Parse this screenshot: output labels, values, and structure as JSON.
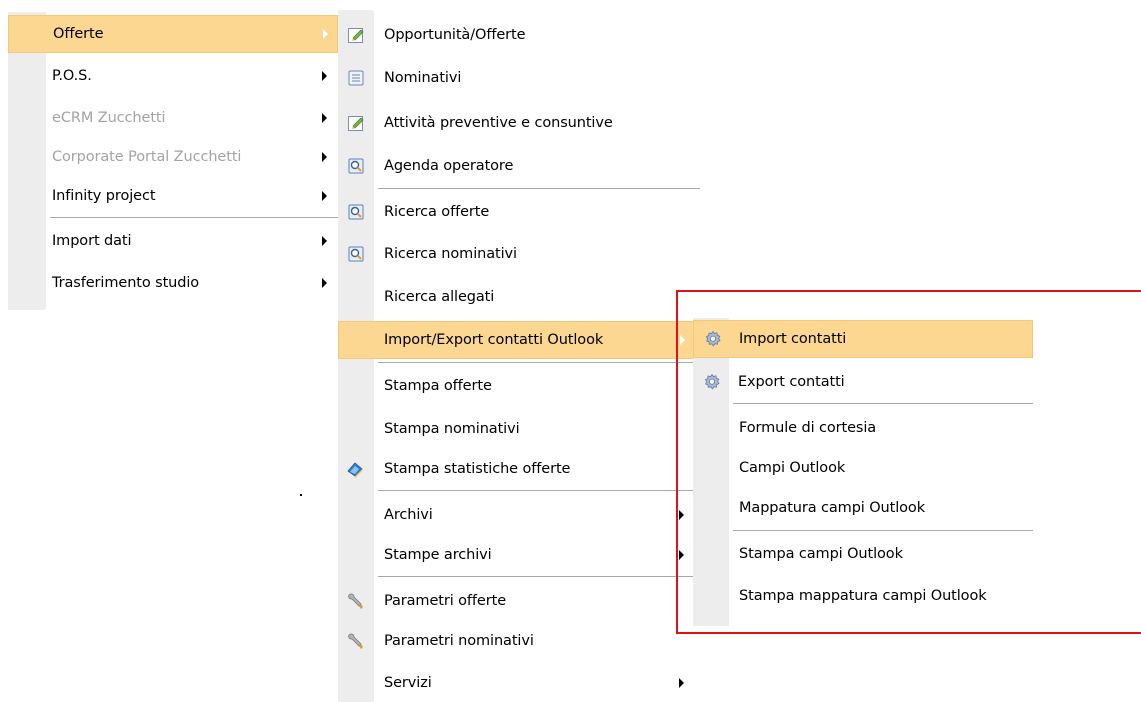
{
  "menu1": {
    "items": [
      {
        "label": "Offerte",
        "state": "highlighted",
        "has_submenu": true
      },
      {
        "label": "P.O.S.",
        "state": "normal",
        "has_submenu": true
      },
      {
        "label": "eCRM Zucchetti",
        "state": "disabled",
        "has_submenu": true
      },
      {
        "label": "Corporate Portal Zucchetti",
        "state": "disabled",
        "has_submenu": true
      },
      {
        "label": "Infinity project",
        "state": "normal",
        "has_submenu": true
      },
      {
        "label": "Import dati",
        "state": "normal",
        "has_submenu": true
      },
      {
        "label": "Trasferimento studio",
        "state": "normal",
        "has_submenu": true
      }
    ]
  },
  "menu2": {
    "items": [
      {
        "label": "Opportunità/Offerte",
        "icon": "edit-document-icon"
      },
      {
        "label": "Nominativi",
        "icon": "list-document-icon"
      },
      {
        "label": "Attività preventive e consuntive",
        "icon": "edit-document-icon"
      },
      {
        "label": "Agenda operatore",
        "icon": "search-document-icon"
      },
      {
        "label": "Ricerca offerte",
        "icon": "search-document-icon"
      },
      {
        "label": "Ricerca nominativi",
        "icon": "search-document-icon"
      },
      {
        "label": "Ricerca allegati"
      },
      {
        "label": "Import/Export contatti Outlook",
        "state": "highlighted",
        "has_submenu": true
      },
      {
        "label": "Stampa offerte"
      },
      {
        "label": "Stampa nominativi"
      },
      {
        "label": "Stampa statistiche offerte",
        "icon": "print-blue-icon"
      },
      {
        "label": "Archivi",
        "has_submenu": true
      },
      {
        "label": "Stampe archivi",
        "has_submenu": true
      },
      {
        "label": "Parametri offerte",
        "icon": "wrench-icon"
      },
      {
        "label": "Parametri nominativi",
        "icon": "wrench-icon"
      },
      {
        "label": "Servizi",
        "has_submenu": true
      }
    ]
  },
  "menu3": {
    "items": [
      {
        "label": "Import contatti",
        "icon": "gear-icon",
        "state": "highlighted"
      },
      {
        "label": "Export contatti",
        "icon": "gear-icon"
      },
      {
        "label": "Formule di cortesia"
      },
      {
        "label": "Campi Outlook"
      },
      {
        "label": "Mappatura campi Outlook"
      },
      {
        "label": "Stampa campi Outlook"
      },
      {
        "label": "Stampa mappatura campi Outlook"
      }
    ]
  },
  "colors": {
    "highlight": "#fbd791",
    "gutter": "#ededed",
    "disabled_text": "#a3a3a3",
    "annotation_box": "#e0101a"
  }
}
